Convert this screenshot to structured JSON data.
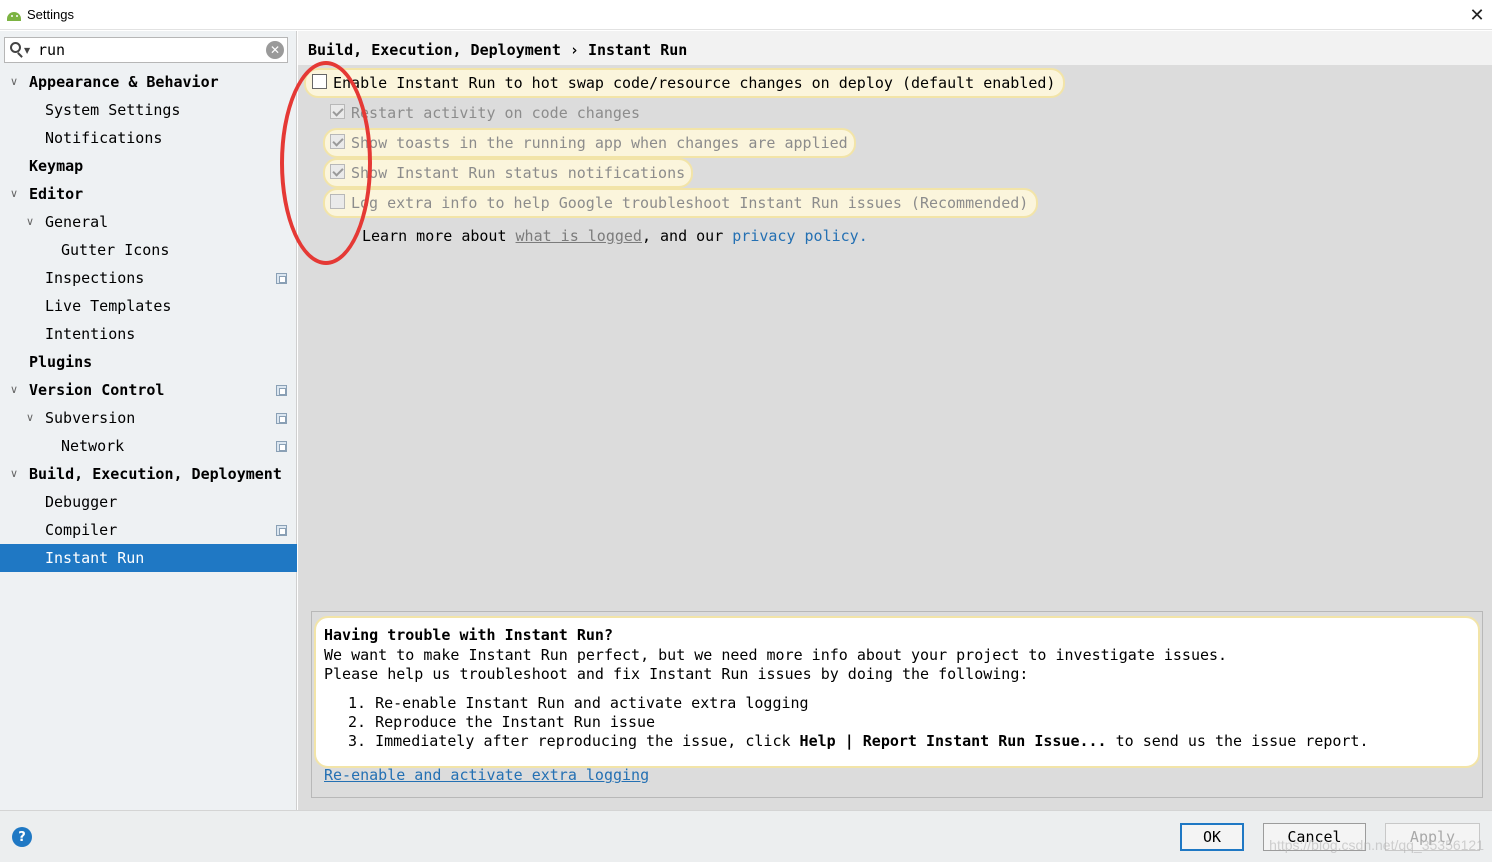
{
  "window": {
    "title": "Settings"
  },
  "search": {
    "value": "run"
  },
  "sidebar": {
    "items": [
      {
        "label": "Appearance & Behavior",
        "level": 0,
        "expanded": true,
        "bold": true
      },
      {
        "label": "System Settings",
        "level": 1
      },
      {
        "label": "Notifications",
        "level": 1
      },
      {
        "label": "Keymap",
        "level": 0,
        "bold": true
      },
      {
        "label": "Editor",
        "level": 0,
        "expanded": true,
        "bold": true
      },
      {
        "label": "General",
        "level": 1,
        "expanded": true
      },
      {
        "label": "Gutter Icons",
        "level": 2
      },
      {
        "label": "Inspections",
        "level": 1,
        "project": true
      },
      {
        "label": "Live Templates",
        "level": 1
      },
      {
        "label": "Intentions",
        "level": 1
      },
      {
        "label": "Plugins",
        "level": 0,
        "bold": true
      },
      {
        "label": "Version Control",
        "level": 0,
        "expanded": true,
        "bold": true,
        "project": true
      },
      {
        "label": "Subversion",
        "level": 1,
        "expanded": true,
        "project": true
      },
      {
        "label": "Network",
        "level": 2,
        "project": true
      },
      {
        "label": "Build, Execution, Deployment",
        "level": 0,
        "expanded": true,
        "bold": true
      },
      {
        "label": "Debugger",
        "level": 1
      },
      {
        "label": "Compiler",
        "level": 1,
        "project": true
      },
      {
        "label": "Instant Run",
        "level": 1,
        "selected": true
      }
    ]
  },
  "breadcrumb": "Build, Execution, Deployment › Instant Run",
  "options": {
    "enable": {
      "label": "Enable Instant Run to hot swap code/resource changes on deploy (default enabled)",
      "checked": false
    },
    "restart": {
      "label": "Restart activity on code changes",
      "checked": true,
      "disabled": true
    },
    "toasts": {
      "label": "Show toasts in the running app when changes are applied",
      "checked": true,
      "disabled": true
    },
    "status": {
      "label": "Show Instant Run status notifications",
      "checked": true,
      "disabled": true
    },
    "log": {
      "label": "Log extra info to help Google troubleshoot Instant Run issues (Recommended)",
      "checked": false,
      "disabled": true
    }
  },
  "learn": {
    "prefix": "Learn more about ",
    "what_link": "what is logged",
    "middle": ", and our ",
    "privacy_link": "privacy policy."
  },
  "trouble": {
    "title": "Having trouble with Instant Run?",
    "line1": "We want to make Instant Run perfect, but we need more info about your project to investigate issues.",
    "line2": "Please help us troubleshoot and fix Instant Run issues by doing the following:",
    "step1": "1. Re-enable Instant Run and activate extra logging",
    "step2": "2. Reproduce the Instant Run issue",
    "step3_prefix": "3. Immediately after reproducing the issue, click ",
    "step3_bold": "Help | Report Instant Run Issue...",
    "step3_suffix": " to send us the issue report.",
    "link": "Re-enable and activate extra logging"
  },
  "buttons": {
    "ok": "OK",
    "cancel": "Cancel",
    "apply": "Apply"
  },
  "watermark": "https://blog.csdn.net/qq_35356121"
}
